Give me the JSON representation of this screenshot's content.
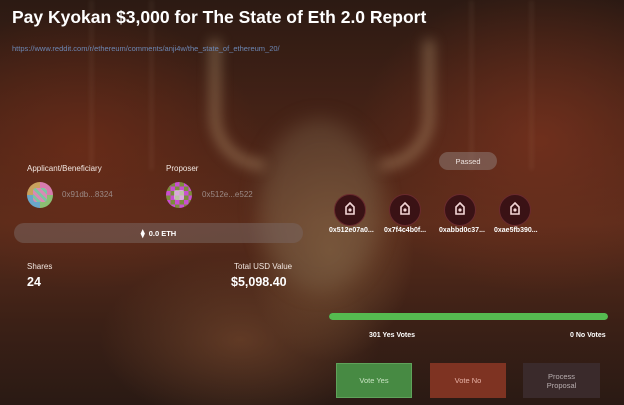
{
  "proposal": {
    "title": "Pay Kyokan $3,000 for The State of Eth 2.0 Report",
    "link": "https://www.reddit.com/r/ethereum/comments/anji4w/the_state_of_ethereum_20/"
  },
  "applicant": {
    "label": "Applicant/Beneficiary",
    "address": "0x91db...8324"
  },
  "proposer": {
    "label": "Proposer",
    "address": "0x512e...e522"
  },
  "tribute": {
    "amount": "0.0 ETH",
    "icon": "ethereum-icon"
  },
  "shares": {
    "label": "Shares",
    "value": "24"
  },
  "total_usd": {
    "label": "Total USD Value",
    "value": "$5,098.40"
  },
  "status": "Passed",
  "voters": [
    {
      "address": "0x512e07a0...",
      "icon": "robot-icon"
    },
    {
      "address": "0x7f4c4b0f...",
      "icon": "robot-icon"
    },
    {
      "address": "0xabbd0c37...",
      "icon": "robot-icon"
    },
    {
      "address": "0xae5fb390...",
      "icon": "robot-icon"
    }
  ],
  "votes": {
    "yes_label": "301 Yes Votes",
    "no_label": "0 No Votes",
    "yes_fraction": 1.0
  },
  "buttons": {
    "vote_yes": "Vote Yes",
    "vote_no": "Vote No",
    "process": "Process Proposal"
  },
  "colors": {
    "progress": "#55bb50",
    "vote_yes": "#478a43",
    "vote_no": "#7e3322",
    "process": "#3a2a2b",
    "link": "#6c87b4"
  }
}
